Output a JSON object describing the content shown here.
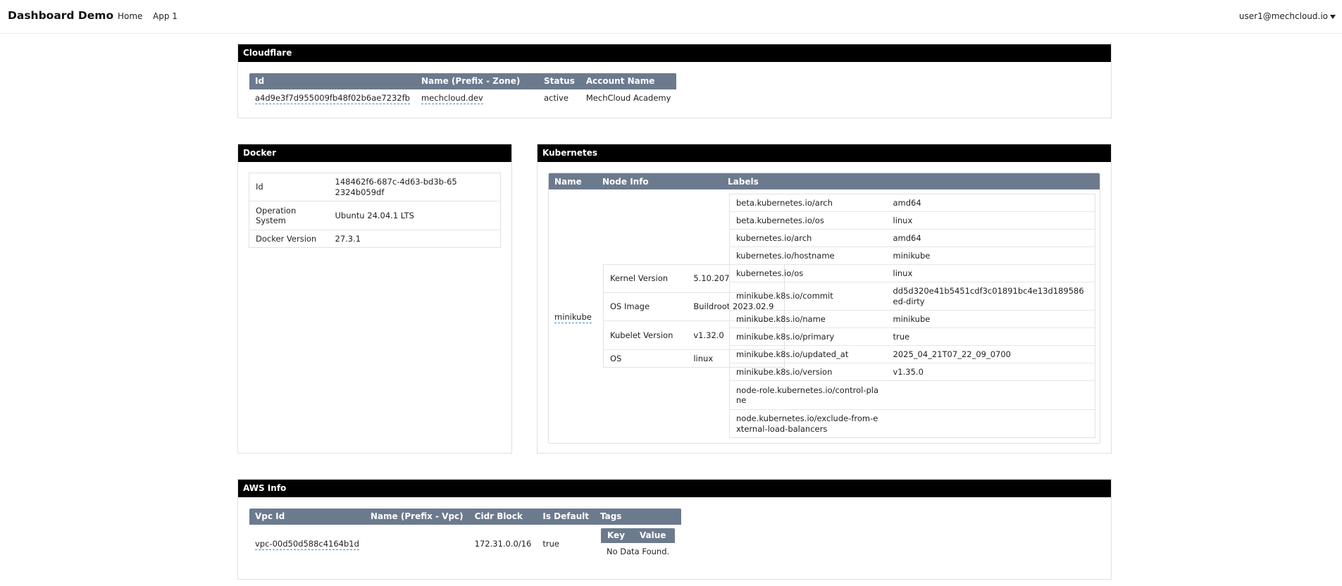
{
  "navbar": {
    "brand": "Dashboard Demo",
    "links": [
      "Home",
      "App 1"
    ],
    "user": "user1@mechcloud.io"
  },
  "cloudflare": {
    "title": "Cloudflare",
    "columns": [
      "Id",
      "Name (Prefix - Zone)",
      "Status",
      "Account Name"
    ],
    "rows": [
      [
        "a4d9e3f7d955009fb48f02b6ae7232fb",
        "mechcloud.dev",
        "active",
        "MechCloud Academy"
      ]
    ]
  },
  "docker": {
    "title": "Docker",
    "rows": [
      {
        "key": "Id",
        "value": "148462f6-687c-4d63-bd3b-652324b059df"
      },
      {
        "key": "Operation System",
        "value": "Ubuntu 24.04.1 LTS"
      },
      {
        "key": "Docker Version",
        "value": "27.3.1"
      }
    ]
  },
  "kubernetes": {
    "title": "Kubernetes",
    "columns": [
      "Name",
      "Node Info",
      "Labels"
    ],
    "node_name": "minikube",
    "node_info": [
      {
        "key": "Kernel Version",
        "value": "5.10.207"
      },
      {
        "key": "OS Image",
        "value": "Buildroot 2023.02.9"
      },
      {
        "key": "Kubelet Version",
        "value": "v1.32.0"
      },
      {
        "key": "OS",
        "value": "linux"
      }
    ],
    "labels": [
      {
        "key": "beta.kubernetes.io/arch",
        "value": "amd64"
      },
      {
        "key": "beta.kubernetes.io/os",
        "value": "linux"
      },
      {
        "key": "kubernetes.io/arch",
        "value": "amd64"
      },
      {
        "key": "kubernetes.io/hostname",
        "value": "minikube"
      },
      {
        "key": "kubernetes.io/os",
        "value": "linux"
      },
      {
        "key": "minikube.k8s.io/commit",
        "value": "dd5d320e41b5451cdf3c01891bc4e13d189586ed-dirty"
      },
      {
        "key": "minikube.k8s.io/name",
        "value": "minikube"
      },
      {
        "key": "minikube.k8s.io/primary",
        "value": "true"
      },
      {
        "key": "minikube.k8s.io/updated_at",
        "value": "2025_04_21T07_22_09_0700"
      },
      {
        "key": "minikube.k8s.io/version",
        "value": "v1.35.0"
      },
      {
        "key": "node-role.kubernetes.io/control-plane",
        "value": ""
      },
      {
        "key": "node.kubernetes.io/exclude-from-external-load-balancers",
        "value": ""
      }
    ]
  },
  "aws": {
    "title": "AWS Info",
    "columns": [
      "Vpc Id",
      "Name (Prefix - Vpc)",
      "Cidr Block",
      "Is Default",
      "Tags"
    ],
    "rows": [
      {
        "vpc_id": "vpc-00d50d588c4164b1d",
        "name": "",
        "cidr": "172.31.0.0/16",
        "is_default": "true"
      }
    ],
    "tags": {
      "columns": [
        "Key",
        "Value"
      ],
      "empty_text": "No Data Found."
    }
  }
}
